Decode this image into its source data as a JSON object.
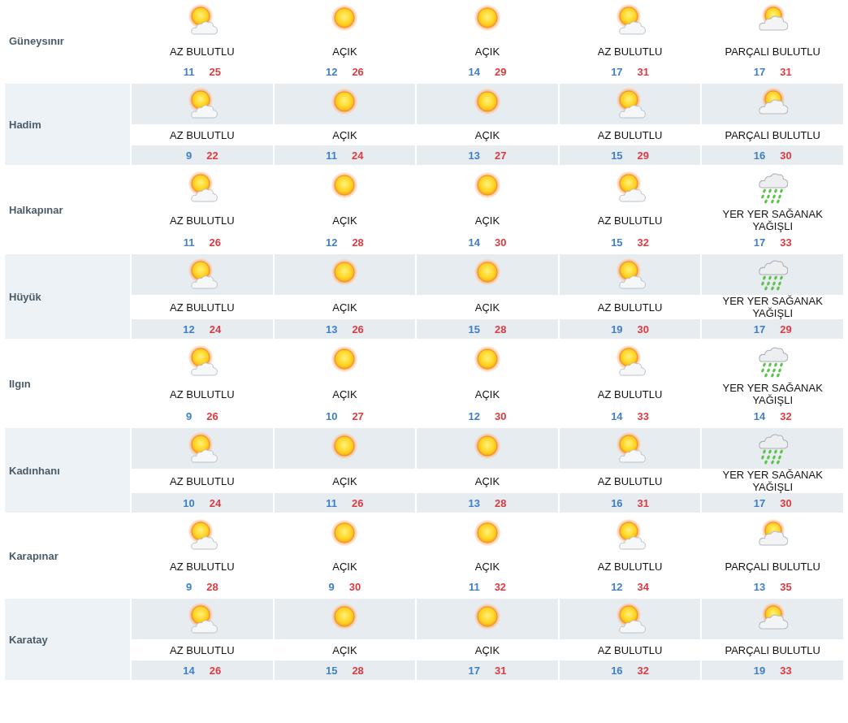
{
  "cities": [
    {
      "name": "Güneysınır",
      "days": [
        {
          "kind": "partly",
          "condition": "AZ BULUTLU",
          "low": "11",
          "high": "25"
        },
        {
          "kind": "clear",
          "condition": "AÇIK",
          "low": "12",
          "high": "26"
        },
        {
          "kind": "clear",
          "condition": "AÇIK",
          "low": "14",
          "high": "29"
        },
        {
          "kind": "partly",
          "condition": "AZ BULUTLU",
          "low": "17",
          "high": "31"
        },
        {
          "kind": "mostly",
          "condition": "PARÇALI BULUTLU",
          "low": "17",
          "high": "31"
        }
      ]
    },
    {
      "name": "Hadim",
      "days": [
        {
          "kind": "partly",
          "condition": "AZ BULUTLU",
          "low": "9",
          "high": "22"
        },
        {
          "kind": "clear",
          "condition": "AÇIK",
          "low": "11",
          "high": "24"
        },
        {
          "kind": "clear",
          "condition": "AÇIK",
          "low": "13",
          "high": "27"
        },
        {
          "kind": "partly",
          "condition": "AZ BULUTLU",
          "low": "15",
          "high": "29"
        },
        {
          "kind": "mostly",
          "condition": "PARÇALI BULUTLU",
          "low": "16",
          "high": "30"
        }
      ]
    },
    {
      "name": "Halkapınar",
      "days": [
        {
          "kind": "partly",
          "condition": "AZ BULUTLU",
          "low": "11",
          "high": "26"
        },
        {
          "kind": "clear",
          "condition": "AÇIK",
          "low": "12",
          "high": "28"
        },
        {
          "kind": "clear",
          "condition": "AÇIK",
          "low": "14",
          "high": "30"
        },
        {
          "kind": "partly",
          "condition": "AZ BULUTLU",
          "low": "15",
          "high": "32"
        },
        {
          "kind": "showers",
          "condition": "YER YER SAĞANAK YAĞIŞLI",
          "low": "17",
          "high": "33"
        }
      ]
    },
    {
      "name": "Hüyük",
      "days": [
        {
          "kind": "partly",
          "condition": "AZ BULUTLU",
          "low": "12",
          "high": "24"
        },
        {
          "kind": "clear",
          "condition": "AÇIK",
          "low": "13",
          "high": "26"
        },
        {
          "kind": "clear",
          "condition": "AÇIK",
          "low": "15",
          "high": "28"
        },
        {
          "kind": "partly",
          "condition": "AZ BULUTLU",
          "low": "19",
          "high": "30"
        },
        {
          "kind": "showers",
          "condition": "YER YER SAĞANAK YAĞIŞLI",
          "low": "17",
          "high": "29"
        }
      ]
    },
    {
      "name": "Ilgın",
      "days": [
        {
          "kind": "partly",
          "condition": "AZ BULUTLU",
          "low": "9",
          "high": "26"
        },
        {
          "kind": "clear",
          "condition": "AÇIK",
          "low": "10",
          "high": "27"
        },
        {
          "kind": "clear",
          "condition": "AÇIK",
          "low": "12",
          "high": "30"
        },
        {
          "kind": "partly",
          "condition": "AZ BULUTLU",
          "low": "14",
          "high": "33"
        },
        {
          "kind": "showers",
          "condition": "YER YER SAĞANAK YAĞIŞLI",
          "low": "14",
          "high": "32"
        }
      ]
    },
    {
      "name": "Kadınhanı",
      "days": [
        {
          "kind": "partly",
          "condition": "AZ BULUTLU",
          "low": "10",
          "high": "24"
        },
        {
          "kind": "clear",
          "condition": "AÇIK",
          "low": "11",
          "high": "26"
        },
        {
          "kind": "clear",
          "condition": "AÇIK",
          "low": "13",
          "high": "28"
        },
        {
          "kind": "partly",
          "condition": "AZ BULUTLU",
          "low": "16",
          "high": "31"
        },
        {
          "kind": "showers",
          "condition": "YER YER SAĞANAK YAĞIŞLI",
          "low": "17",
          "high": "30"
        }
      ]
    },
    {
      "name": "Karapınar",
      "days": [
        {
          "kind": "partly",
          "condition": "AZ BULUTLU",
          "low": "9",
          "high": "28"
        },
        {
          "kind": "clear",
          "condition": "AÇIK",
          "low": "9",
          "high": "30"
        },
        {
          "kind": "clear",
          "condition": "AÇIK",
          "low": "11",
          "high": "32"
        },
        {
          "kind": "partly",
          "condition": "AZ BULUTLU",
          "low": "12",
          "high": "34"
        },
        {
          "kind": "mostly",
          "condition": "PARÇALI BULUTLU",
          "low": "13",
          "high": "35"
        }
      ]
    },
    {
      "name": "Karatay",
      "days": [
        {
          "kind": "partly",
          "condition": "AZ BULUTLU",
          "low": "14",
          "high": "26"
        },
        {
          "kind": "clear",
          "condition": "AÇIK",
          "low": "15",
          "high": "28"
        },
        {
          "kind": "clear",
          "condition": "AÇIK",
          "low": "17",
          "high": "31"
        },
        {
          "kind": "partly",
          "condition": "AZ BULUTLU",
          "low": "16",
          "high": "32"
        },
        {
          "kind": "mostly",
          "condition": "PARÇALI BULUTLU",
          "low": "19",
          "high": "33"
        }
      ]
    }
  ]
}
